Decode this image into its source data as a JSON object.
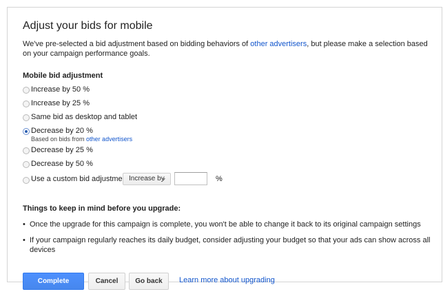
{
  "title": "Adjust your bids for mobile",
  "intro": {
    "text_before": "We've pre-selected a bid adjustment based on bidding behaviors of ",
    "link": "other advertisers",
    "text_after": ", but please make a selection based on your campaign performance goals."
  },
  "mobile_section": {
    "heading": "Mobile bid adjustment",
    "options": [
      {
        "label": "Increase by 50 %",
        "selected": false
      },
      {
        "label": "Increase by 25 %",
        "selected": false
      },
      {
        "label": "Same bid as desktop and tablet",
        "selected": false
      },
      {
        "label": "Decrease by 20 %",
        "selected": true
      },
      {
        "label": "Decrease by 25 %",
        "selected": false
      },
      {
        "label": "Decrease by 50 %",
        "selected": false
      }
    ],
    "recommended_note": {
      "text": "Based on bids from ",
      "link": "other advertisers"
    },
    "custom": {
      "label": "Use a custom bid adjustment:",
      "dropdown_value": "Increase by",
      "input_value": "",
      "unit": "%"
    }
  },
  "keep_in_mind": {
    "heading": "Things to keep in mind before you upgrade:",
    "bullets": [
      "Once the upgrade for this campaign is complete, you won't be able to change it back to its original campaign settings",
      "If your campaign regularly reaches its daily budget, consider adjusting your budget so that your ads can show across all devices"
    ]
  },
  "actions": {
    "complete": "Complete upgrade",
    "cancel": "Cancel",
    "back": "Go back",
    "learn_more": "Learn more about upgrading"
  }
}
